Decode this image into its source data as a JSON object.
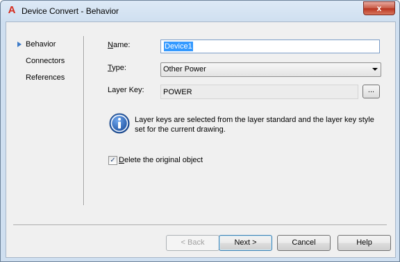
{
  "window": {
    "title": "Device Convert - Behavior",
    "close_glyph": "x",
    "app_icon": "A"
  },
  "nav": {
    "items": [
      {
        "label": "Behavior"
      },
      {
        "label": "Connectors"
      },
      {
        "label": "References"
      }
    ]
  },
  "form": {
    "name_label": {
      "mnemonic": "N",
      "rest": "ame:"
    },
    "name_value": "Device1",
    "type_label": {
      "mnemonic": "T",
      "rest": "ype:"
    },
    "type_value": "Other Power",
    "layer_key_label": "Layer Key:",
    "layer_key_value": "POWER",
    "browse_label": "...",
    "info_text": "Layer keys are selected from the layer standard and the layer key style set for the current drawing.",
    "delete_original": {
      "checked": true,
      "mnemonic": "D",
      "rest": "elete the original object",
      "check_glyph": "✓"
    }
  },
  "buttons": {
    "back": "< Back",
    "next": "Next >",
    "cancel": "Cancel",
    "help": "Help"
  },
  "colors": {
    "accent": "#3d7bc8",
    "selection": "#3399ff",
    "close": "#c75a44"
  }
}
